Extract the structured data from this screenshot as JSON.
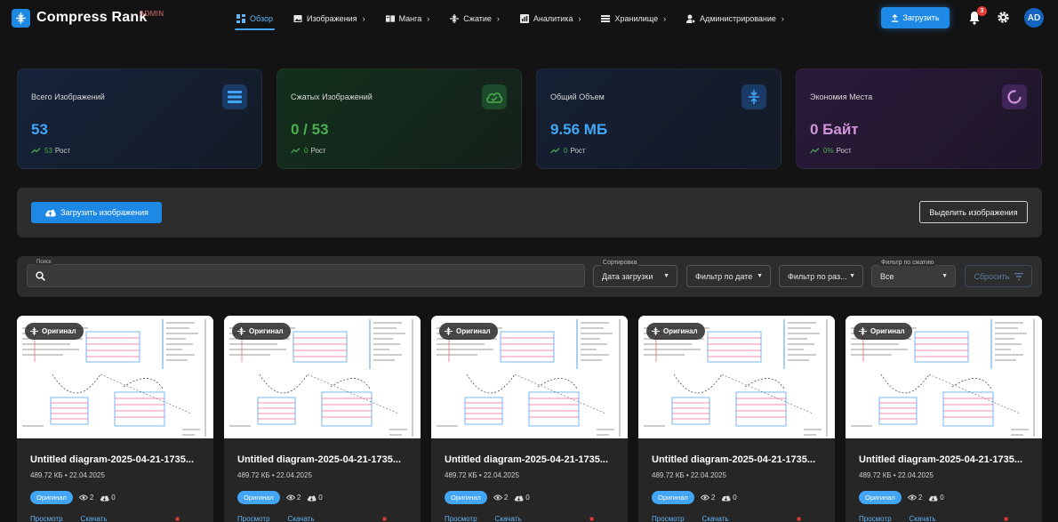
{
  "app": {
    "name": "Compress Rank",
    "badge": "ADMIN"
  },
  "nav": [
    {
      "label": "Обзор",
      "icon": "dashboard-icon",
      "active": true
    },
    {
      "label": "Изображения",
      "icon": "image-icon"
    },
    {
      "label": "Манга",
      "icon": "book-icon"
    },
    {
      "label": "Сжатие",
      "icon": "compress-icon"
    },
    {
      "label": "Аналитика",
      "icon": "analytics-icon"
    },
    {
      "label": "Хранилище",
      "icon": "storage-icon"
    },
    {
      "label": "Администрирование",
      "icon": "admin-icon"
    }
  ],
  "header": {
    "upload_label": "Загрузить",
    "notifications_count": "3",
    "avatar_initials": "AD"
  },
  "stats": [
    {
      "label": "Всего Изображений",
      "value": "53",
      "trend_value": "53",
      "trend_label": "Рост",
      "color": "#42a5f5",
      "icon": "list-icon"
    },
    {
      "label": "Сжатых Изображений",
      "value": "0 / 53",
      "trend_value": "0",
      "trend_label": "Рост",
      "color": "#4caf50",
      "icon": "cloud-done-icon"
    },
    {
      "label": "Общий Объем",
      "value": "9.56 МБ",
      "trend_value": "0",
      "trend_label": "Рост",
      "color": "#42a5f5",
      "icon": "compress-icon"
    },
    {
      "label": "Экономия Места",
      "value": "0 Байт",
      "trend_value": "0%",
      "trend_label": "Рост",
      "color": "#ce93d8",
      "icon": "progress-ring-icon"
    }
  ],
  "actions": {
    "upload_images": "Загрузить изображения",
    "select_images": "Выделить изображения"
  },
  "filters": {
    "search_label": "Поиск",
    "search_value": "",
    "sort_label": "Сортировка",
    "sort_value": "Дата загрузки",
    "date_filter": "Фильтр по дате",
    "size_filter": "Фильтр по раз...",
    "compress_filter_label": "Фильтр по сжатию",
    "compress_filter_value": "Все",
    "reset_label": "Сбросить"
  },
  "cards": [
    {
      "chip": "Оригинал",
      "title": "Untitled diagram-2025-04-21-1735...",
      "meta": "489.72 КБ • 22.04.2025",
      "badge": "Оригинал",
      "views": "2",
      "downloads": "0",
      "action1": "Просмотр",
      "action2": "Скачать"
    },
    {
      "chip": "Оригинал",
      "title": "Untitled diagram-2025-04-21-1735...",
      "meta": "489.72 КБ • 22.04.2025",
      "badge": "Оригинал",
      "views": "2",
      "downloads": "0",
      "action1": "Просмотр",
      "action2": "Скачать"
    },
    {
      "chip": "Оригинал",
      "title": "Untitled diagram-2025-04-21-1735...",
      "meta": "489.72 КБ • 22.04.2025",
      "badge": "Оригинал",
      "views": "2",
      "downloads": "0",
      "action1": "Просмотр",
      "action2": "Скачать"
    },
    {
      "chip": "Оригинал",
      "title": "Untitled diagram-2025-04-21-1735...",
      "meta": "489.72 КБ • 22.04.2025",
      "badge": "Оригинал",
      "views": "2",
      "downloads": "0",
      "action1": "Просмотр",
      "action2": "Скачать"
    },
    {
      "chip": "Оригинал",
      "title": "Untitled diagram-2025-04-21-1735...",
      "meta": "489.72 КБ • 22.04.2025",
      "badge": "Оригинал",
      "views": "2",
      "downloads": "0",
      "action1": "Просмотр",
      "action2": "Скачать"
    }
  ]
}
